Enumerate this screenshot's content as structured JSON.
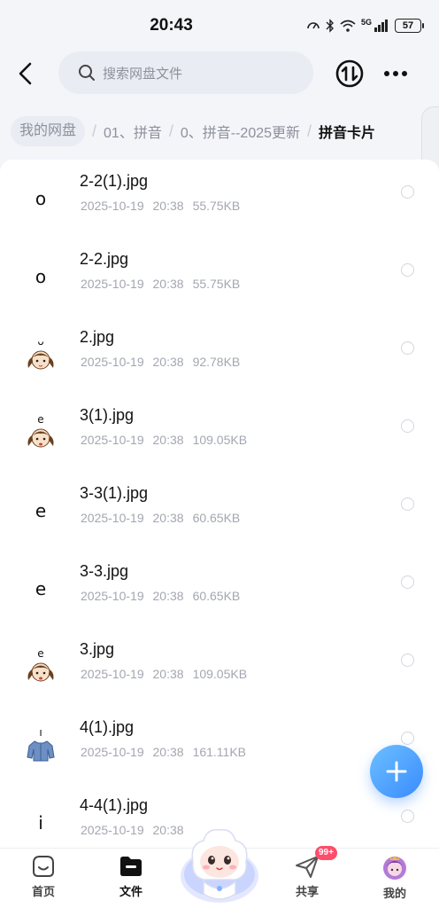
{
  "status_bar": {
    "time": "20:43",
    "network": "5G",
    "battery": "57"
  },
  "header": {
    "search_placeholder": "搜索网盘文件"
  },
  "breadcrumb": {
    "root": "我的网盘",
    "items": [
      "01、拼音",
      "0、拼音--2025更新"
    ],
    "current": "拼音卡片"
  },
  "files": [
    {
      "name": "2-2(1).jpg",
      "date": "2025-10-19",
      "time": "20:38",
      "size": "55.75KB",
      "thumb_icon": "letter-o-thumbnail"
    },
    {
      "name": "2-2.jpg",
      "date": "2025-10-19",
      "time": "20:38",
      "size": "55.75KB",
      "thumb_icon": "letter-o-thumbnail"
    },
    {
      "name": "2.jpg",
      "date": "2025-10-19",
      "time": "20:38",
      "size": "92.78KB",
      "thumb_icon": "girl-face-thumbnail"
    },
    {
      "name": "3(1).jpg",
      "date": "2025-10-19",
      "time": "20:38",
      "size": "109.05KB",
      "thumb_icon": "girl-face-thumbnail"
    },
    {
      "name": "3-3(1).jpg",
      "date": "2025-10-19",
      "time": "20:38",
      "size": "60.65KB",
      "thumb_icon": "letter-e-thumbnail"
    },
    {
      "name": "3-3.jpg",
      "date": "2025-10-19",
      "time": "20:38",
      "size": "60.65KB",
      "thumb_icon": "letter-e-thumbnail"
    },
    {
      "name": "3.jpg",
      "date": "2025-10-19",
      "time": "20:38",
      "size": "109.05KB",
      "thumb_icon": "girl-face-thumbnail"
    },
    {
      "name": "4(1).jpg",
      "date": "2025-10-19",
      "time": "20:38",
      "size": "161.11KB",
      "thumb_icon": "shirt-thumbnail"
    },
    {
      "name": "4-4(1).jpg",
      "date": "2025-10-19",
      "time": "20:38",
      "size": "",
      "thumb_icon": "letter-i-thumbnail"
    }
  ],
  "nav": {
    "home": "首页",
    "files": "文件",
    "share": "共享",
    "mine": "我的",
    "share_badge": "99+"
  },
  "colors": {
    "accent": "#3a8bff",
    "badge": "#ff4d6a",
    "text_secondary": "#a3a7b0"
  }
}
